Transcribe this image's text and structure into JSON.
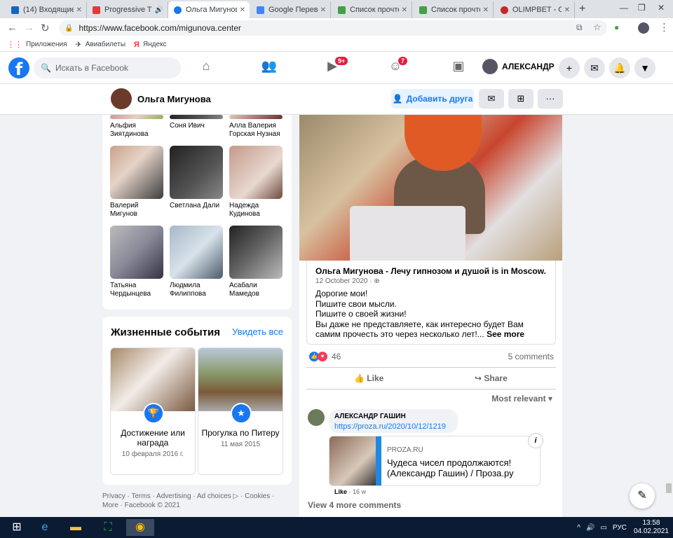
{
  "browser": {
    "tabs": [
      {
        "title": "(14) Входящие -",
        "color": "#1565c0"
      },
      {
        "title": "Progressive T",
        "color": "#e53935"
      },
      {
        "title": "Ольга Мигунова",
        "color": "#1877f2",
        "active": true
      },
      {
        "title": "Google Перевод",
        "color": "#4285f4"
      },
      {
        "title": "Список прочтен",
        "color": "#43a047"
      },
      {
        "title": "Список прочтен",
        "color": "#43a047"
      },
      {
        "title": "OLIMPBET - Спо",
        "color": "#c62828"
      }
    ],
    "url": "https://www.facebook.com/migunova.center",
    "bookmarks": [
      {
        "icon": "apps",
        "label": "Приложения"
      },
      {
        "icon": "plane",
        "label": "Авиабилеты"
      },
      {
        "icon": "yandex",
        "label": "Яндекс"
      }
    ]
  },
  "fb": {
    "search_placeholder": "Искать в Facebook",
    "watch_badge": "9+",
    "groups_badge": "7",
    "user_name": "АЛЕКСАНДР",
    "profile_name": "Ольга Мигунова",
    "add_friend": "Добавить друга"
  },
  "friends": [
    {
      "name": "Альфия Зиятдинова"
    },
    {
      "name": "Соня Ивич"
    },
    {
      "name": "Алла Валерия Горская Нузная"
    },
    {
      "name": "Валерий Мигунов"
    },
    {
      "name": "Светлана Дали"
    },
    {
      "name": "Надежда Кудинова"
    },
    {
      "name": "Татьяна Чердынцева"
    },
    {
      "name": "Людмила Филиппова"
    },
    {
      "name": "Асабали Мамедов"
    }
  ],
  "life_events": {
    "title": "Жизненные события",
    "see_all": "Увидеть все",
    "items": [
      {
        "title": "Достижение или награда",
        "date": "10 февраля 2016 г."
      },
      {
        "title": "Прогулка по Питеру",
        "date": "11 мая 2015"
      }
    ]
  },
  "footer": "Privacy · Terms · Advertising · Ad choices ▷ · Cookies · More · Facebook © 2021",
  "post": {
    "author": "Ольга Мигунова - Лечу гипнозом и душой is in Moscow.",
    "date": "12 October 2020 · ⊕",
    "text": "Дорогие мои!\nПишите свои мысли.\nПишите о своей жизни!\nВы даже не представляете, как интересно будет Вам самим прочесть это через несколько лет!...",
    "see_more": "See more",
    "reactions_count": "46",
    "comments_count": "5 comments",
    "like": "Like",
    "share": "Share",
    "most_relevant": "Most relevant ▾",
    "comment_author": "АЛЕКСАНДР ГАШИН",
    "comment_link": "https://proza.ru/2020/10/12/1219",
    "link_domain": "PROZA.RU",
    "link_title": "Чудеса чисел продолжаются! (Александр Гашин) / Проза.ру",
    "comment_like": "Like",
    "comment_time": "· 16 w",
    "view_more": "View 4 more comments"
  },
  "taskbar": {
    "lang": "РУС",
    "time": "13:58",
    "date": "04.02.2021"
  }
}
